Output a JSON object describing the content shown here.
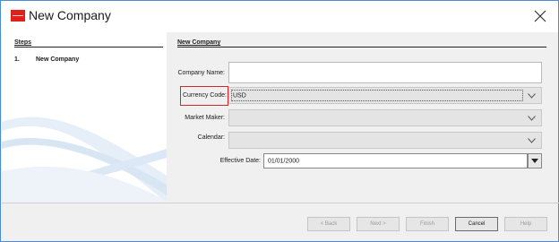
{
  "window": {
    "title": "New Company"
  },
  "steps": {
    "header": "Steps",
    "items": [
      {
        "num": "1.",
        "label": "New Company"
      }
    ]
  },
  "form": {
    "header": "New Company",
    "company_name": {
      "label": "Company Name:",
      "value": ""
    },
    "currency_code": {
      "label": "Currency Code:",
      "value": "USD"
    },
    "market_maker": {
      "label": "Market Maker:",
      "value": ""
    },
    "calendar": {
      "label": "Calendar:",
      "value": ""
    },
    "effective_date": {
      "label": "Effective Date:",
      "value": "01/01/2000"
    }
  },
  "buttons": {
    "back": "< Back",
    "next": "Next >",
    "finish": "Finish",
    "cancel": "Cancel",
    "help": "Help"
  },
  "colors": {
    "highlight": "#cc2a2a",
    "window_border": "#4a8cd8",
    "logo": "#e0201b"
  }
}
